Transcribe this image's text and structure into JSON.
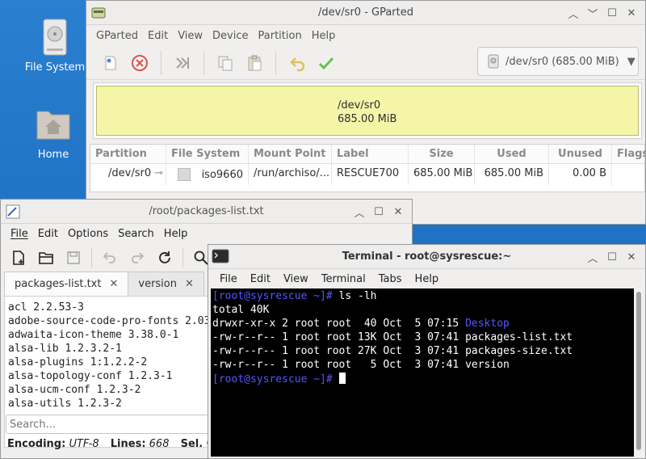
{
  "desktop": {
    "icons": [
      {
        "label": "File System",
        "icon": "drive-icon"
      },
      {
        "label": "Home",
        "icon": "home-folder-icon"
      }
    ]
  },
  "gparted": {
    "title": "/dev/sr0 - GParted",
    "menu": [
      "GParted",
      "Edit",
      "View",
      "Device",
      "Partition",
      "Help"
    ],
    "device_select": "/dev/sr0 (685.00 MiB)",
    "partition_bar": {
      "name": "/dev/sr0",
      "size": "685.00 MiB",
      "color": "#f5f5a8"
    },
    "table": {
      "columns": [
        "Partition",
        "File System",
        "Mount Point",
        "Label",
        "Size",
        "Used",
        "Unused",
        "Flags"
      ],
      "rows": [
        {
          "partition": "/dev/sr0",
          "filesystem": "iso9660",
          "mountpoint": "/run/archiso/...",
          "label": "RESCUE700",
          "size": "685.00 MiB",
          "used": "685.00 MiB",
          "unused": "0.00 B",
          "flags": ""
        }
      ]
    }
  },
  "mousepad": {
    "title": "/root/packages-list.txt",
    "menu": [
      "File",
      "Edit",
      "Options",
      "Search",
      "Help"
    ],
    "tabs": [
      {
        "label": "packages-list.txt"
      },
      {
        "label": "version"
      }
    ],
    "lines": [
      "acl 2.2.53-3",
      "adobe-source-code-pro-fonts 2.03",
      "adwaita-icon-theme 3.38.0-1",
      "alsa-lib 1.2.3.2-1",
      "alsa-plugins 1:1.2.2-2",
      "alsa-topology-conf 1.2.3-1",
      "alsa-ucm-conf 1.2.3-2",
      "alsa-utils 1.2.3-2"
    ],
    "search_placeholder": "Search...",
    "status": {
      "encoding_label": "Encoding:",
      "encoding": "UTF-8",
      "lines_label": "Lines:",
      "lines": "668",
      "sel_label": "Sel. C"
    }
  },
  "terminal": {
    "title": "Terminal - root@sysrescue:~",
    "menu": [
      "File",
      "Edit",
      "View",
      "Terminal",
      "Tabs",
      "Help"
    ],
    "prompt": "[root@sysrescue ~]#",
    "command": " ls -lh",
    "total": "total 40K",
    "listing": [
      {
        "meta": "drwxr-xr-x 2 root root  40 Oct  5 07:15 ",
        "name": "Desktop",
        "is_dir": true
      },
      {
        "meta": "-rw-r--r-- 1 root root 13K Oct  3 07:41 ",
        "name": "packages-list.txt",
        "is_dir": false
      },
      {
        "meta": "-rw-r--r-- 1 root root 27K Oct  3 07:41 ",
        "name": "packages-size.txt",
        "is_dir": false
      },
      {
        "meta": "-rw-r--r-- 1 root root   5 Oct  3 07:41 ",
        "name": "version",
        "is_dir": false
      }
    ]
  }
}
